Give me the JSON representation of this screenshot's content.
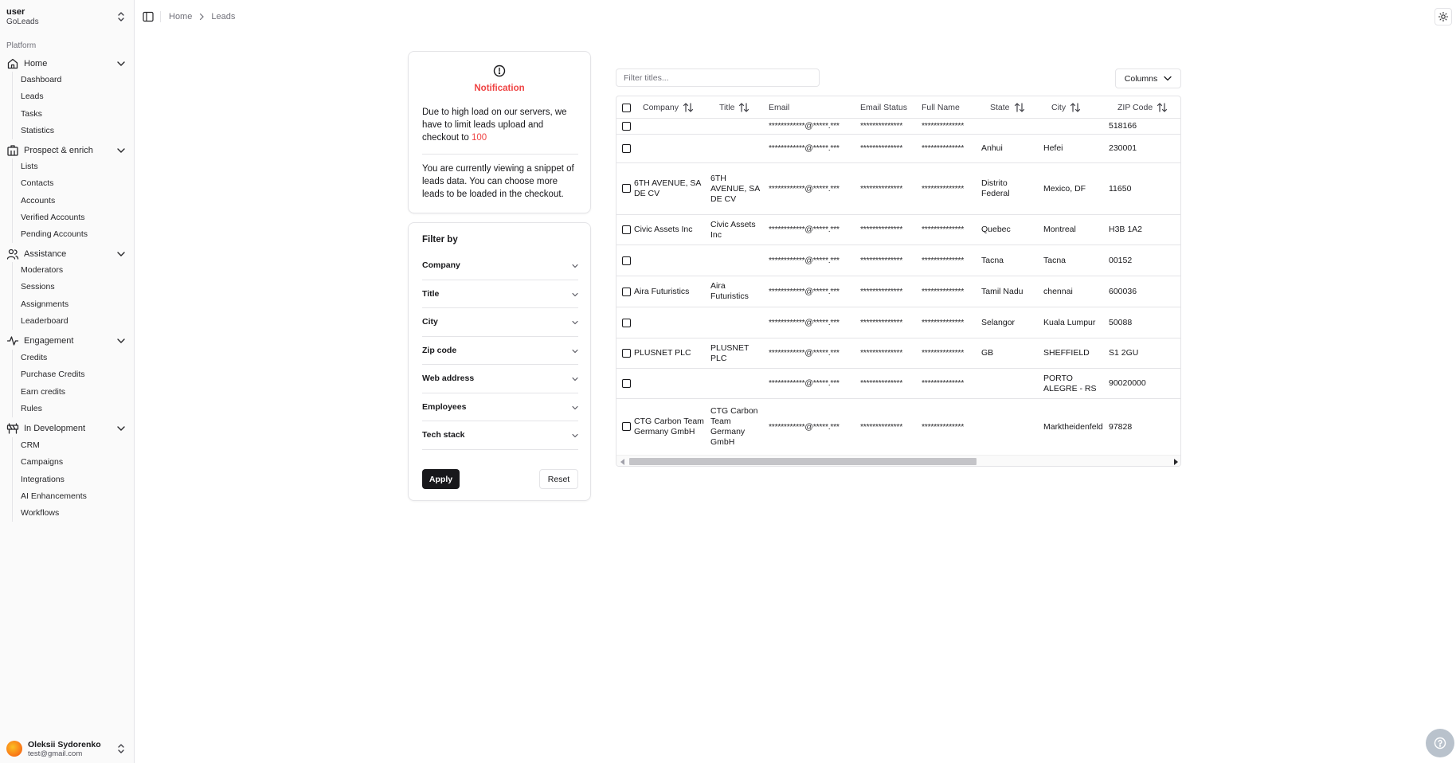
{
  "workspace": {
    "user": "user",
    "org": "GoLeads"
  },
  "sidebar": {
    "section_label": "Platform",
    "groups": [
      {
        "label": "Home",
        "icon": "home-icon",
        "items": [
          "Dashboard",
          "Leads",
          "Tasks",
          "Statistics"
        ]
      },
      {
        "label": "Prospect & enrich",
        "icon": "building-icon",
        "items": [
          "Lists",
          "Contacts",
          "Accounts",
          "Verified Accounts",
          "Pending Accounts"
        ]
      },
      {
        "label": "Assistance",
        "icon": "users-icon",
        "items": [
          "Moderators",
          "Sessions",
          "Assignments",
          "Leaderboard"
        ]
      },
      {
        "label": "Engagement",
        "icon": "activity-icon",
        "items": [
          "Credits",
          "Purchase Credits",
          "Earn credits",
          "Rules"
        ]
      },
      {
        "label": "In Development",
        "icon": "construction-icon",
        "items": [
          "CRM",
          "Campaigns",
          "Integrations",
          "AI Enhancements",
          "Workflows"
        ]
      }
    ]
  },
  "account": {
    "name": "Oleksii Sydorenko",
    "email": "test@gmail.com"
  },
  "breadcrumb": {
    "home": "Home",
    "current": "Leads"
  },
  "notification": {
    "title": "Notification",
    "text1_prefix": "Due to high load on our servers, we have to limit leads upload and checkout to ",
    "limit": "100",
    "text2": "You are currently viewing a snippet of leads data. You can choose more leads to be loaded in the checkout."
  },
  "filter": {
    "title": "Filter by",
    "items": [
      "Company",
      "Title",
      "City",
      "Zip code",
      "Web address",
      "Employees",
      "Tech stack"
    ],
    "apply": "Apply",
    "reset": "Reset"
  },
  "table": {
    "search_placeholder": "Filter titles...",
    "columns_button": "Columns",
    "headers": {
      "company": "Company",
      "title": "Title",
      "email": "Email",
      "email_status": "Email Status",
      "full_name": "Full Name",
      "state": "State",
      "city": "City",
      "zip": "ZIP Code"
    },
    "masked_email": "************@*****.***",
    "masked_text": "**************",
    "rows": [
      {
        "company": "",
        "title": "",
        "state": "",
        "city": "",
        "zip": "518166"
      },
      {
        "company": "",
        "title": "",
        "state": "Anhui",
        "city": "Hefei",
        "zip": "230001"
      },
      {
        "company": "6TH AVENUE, SA DE CV",
        "title": "6TH AVENUE, SA DE CV",
        "state": "Distrito Federal",
        "city": "Mexico, DF",
        "zip": "11650"
      },
      {
        "company": "Civic Assets Inc",
        "title": "Civic Assets Inc",
        "state": "Quebec",
        "city": "Montreal",
        "zip": "H3B 1A2"
      },
      {
        "company": "",
        "title": "",
        "state": "Tacna",
        "city": "Tacna",
        "zip": "00152"
      },
      {
        "company": "Aira Futuristics",
        "title": "Aira Futuristics",
        "state": "Tamil Nadu",
        "city": "chennai",
        "zip": "600036"
      },
      {
        "company": "",
        "title": "",
        "state": "Selangor",
        "city": "Kuala Lumpur",
        "zip": "50088"
      },
      {
        "company": "PLUSNET PLC",
        "title": "PLUSNET PLC",
        "state": "GB",
        "city": "SHEFFIELD",
        "zip": "S1 2GU"
      },
      {
        "company": "",
        "title": "",
        "state": "",
        "city": "PORTO ALEGRE - RS",
        "zip": "90020000"
      },
      {
        "company": "CTG Carbon Team Germany GmbH",
        "title": "CTG Carbon Team Germany GmbH",
        "state": "",
        "city": "Marktheidenfeld",
        "zip": "97828"
      }
    ]
  },
  "colors": {
    "accent_red": "#ef4444",
    "primary": "#18181b",
    "border": "#e4e4e7",
    "help_button": "#b9c2cc"
  }
}
